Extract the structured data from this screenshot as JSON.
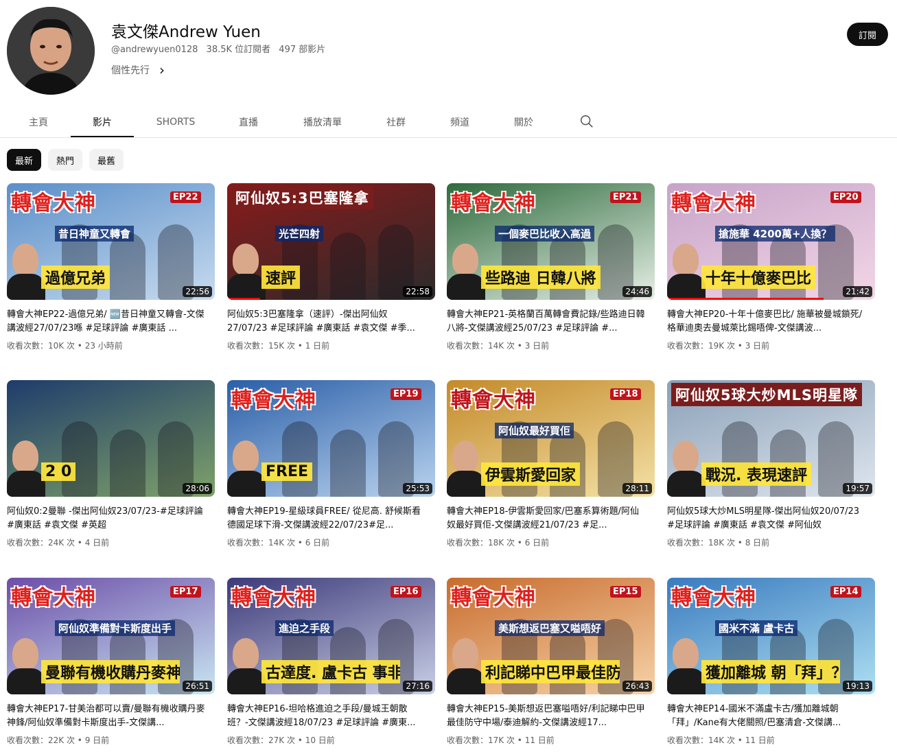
{
  "channel": {
    "name": "袁文傑Andrew Yuen",
    "handle": "@andrewyuen0128",
    "subscribers": "38.5K 位訂閱者",
    "video_count": "497 部影片",
    "about_link": "個性先行",
    "subscribe_label": "訂閱"
  },
  "tabs": [
    "主頁",
    "影片",
    "SHORTS",
    "直播",
    "播放清單",
    "社群",
    "頻道",
    "關於"
  ],
  "active_tab": "影片",
  "chips": [
    "最新",
    "熱門",
    "最舊"
  ],
  "active_chip": "最新",
  "videos": [
    {
      "title": "轉會大神EP22-過億兄弟/ 🆕昔日神童又轉會-文傑講波經27/07/23喺 #足球評論 #廣東話 ...",
      "views": "收看次數：10K 次",
      "age": "23 小時前",
      "duration": "22:56",
      "thumb": {
        "banner": "轉會大神",
        "ep": "EP22",
        "caption": "過億兄弟",
        "caption2": "昔日神童又轉會",
        "colors": [
          "#5b8fc9",
          "#c7dbef"
        ],
        "banner_color": "#e0201c"
      }
    },
    {
      "title": "阿仙奴5:3巴塞隆拿（速評）-傑出阿仙奴27/07/23 #足球評論 #廣東話 #袁文傑 #季...",
      "views": "收看次數：15K 次",
      "age": "1 日前",
      "duration": "22:58",
      "thumb": {
        "banner": "阿仙奴5:3巴塞隆拿",
        "ep": "",
        "caption": "速評",
        "caption2": "光芒四射",
        "colors": [
          "#8a1a1a",
          "#2b2b2b"
        ],
        "banner_color": "#ffffff"
      }
    },
    {
      "title": "轉會大神EP21-英格蘭百萬轉會費記錄/些路迪日韓八將-文傑講波經25/07/23 #足球評論 #...",
      "views": "收看次數：14K 次",
      "age": "3 日前",
      "duration": "24:46",
      "thumb": {
        "banner": "轉會大神",
        "ep": "EP21",
        "caption": "些路迪 日韓八將",
        "caption2": "一個麥巴比收入高過",
        "colors": [
          "#2f6b3d",
          "#e6efe6"
        ],
        "banner_color": "#e0201c"
      }
    },
    {
      "title": "轉會大神EP20-十年十億麥巴比/ 施華被曼城鎖死/ 格華迪奧去曼城萊比錫唔俾-文傑講波...",
      "views": "收看次數：19K 次",
      "age": "3 日前",
      "duration": "21:42",
      "thumb": {
        "banner": "轉會大神",
        "ep": "EP20",
        "caption": "十年十億麥巴比",
        "caption2": "搶施華 4200萬+人換？",
        "colors": [
          "#c7a3c9",
          "#f2d7e6"
        ],
        "banner_color": "#e0201c"
      }
    },
    {
      "title": "阿仙奴0:2曼聯 -傑出阿仙奴23/07/23-#足球評論 #廣東話 #袁文傑 #英超",
      "views": "收看次數：24K 次",
      "age": "4 日前",
      "duration": "28:06",
      "thumb": {
        "banner": "",
        "ep": "",
        "caption": "2  0",
        "caption2": "",
        "colors": [
          "#1e3c6b",
          "#7fa26a"
        ],
        "banner_color": "#ffffff"
      }
    },
    {
      "title": "轉會大神EP19-星級球員FREE/ 從尼高. 舒候斯看德國足球下滑-文傑講波經22/07/23#足...",
      "views": "收看次數：14K 次",
      "age": "6 日前",
      "duration": "25:53",
      "thumb": {
        "banner": "轉會大神",
        "ep": "EP19",
        "caption": "FREE",
        "caption2": "",
        "colors": [
          "#2b5fa8",
          "#b9d3ee"
        ],
        "banner_color": "#e0201c"
      }
    },
    {
      "title": "轉會大神EP18-伊雲斯愛回家/巴塞系算術題/阿仙奴最好買佢-文傑講波經21/07/23 #足...",
      "views": "收看次數：18K 次",
      "age": "6 日前",
      "duration": "28:11",
      "thumb": {
        "banner": "轉會大神",
        "ep": "EP18",
        "caption": "伊雲斯愛回家",
        "caption2": "阿仙奴最好買佢",
        "colors": [
          "#c48a2a",
          "#f3e1a6"
        ],
        "banner_color": "#c0141c"
      }
    },
    {
      "title": "阿仙奴5球大炒MLS明星隊-傑出阿仙奴20/07/23 #足球評論 #廣東話 #袁文傑 #阿仙奴",
      "views": "收看次數：18K 次",
      "age": "8 日前",
      "duration": "19:57",
      "thumb": {
        "banner": "阿仙奴5球大炒MLS明星隊",
        "ep": "",
        "caption": "戰況. 表現速評",
        "caption2": "",
        "colors": [
          "#8aa0b8",
          "#dfe6ee"
        ],
        "banner_color": "#ffffff"
      }
    },
    {
      "title": "轉會大神EP17-甘美治都可以賣/曼聯有機收購丹麥神鋒/阿仙奴準備對卡斯度出手-文傑講...",
      "views": "收看次數：22K 次",
      "age": "9 日前",
      "duration": "26:51",
      "thumb": {
        "banner": "轉會大神",
        "ep": "EP17",
        "caption": "曼聯有機收購丹麥神鋒",
        "caption2": "阿仙奴準備對卡斯度出手",
        "colors": [
          "#6d4ea8",
          "#c9e6f2"
        ],
        "banner_color": "#e0201c"
      }
    },
    {
      "title": "轉會大神EP16-坦哈格進迫之手段/曼城王朝散班？-文傑講波經18/07/23 #足球評論 #廣東...",
      "views": "收看次數：27K 次",
      "age": "10 日前",
      "duration": "27:16",
      "thumb": {
        "banner": "轉會大神",
        "ep": "EP16",
        "caption": "古達度. 盧卡古 事非沒完沒了",
        "caption2": "進迫之手段",
        "colors": [
          "#3d3a7a",
          "#c9cfe6"
        ],
        "banner_color": "#e0201c"
      }
    },
    {
      "title": "轉會大神EP15-美斯想返巴塞嗌唔好/利記睇中巴甲最佳防守中場/泰迪解約-文傑講波經17...",
      "views": "收看次數：17K 次",
      "age": "11 日前",
      "duration": "26:43",
      "thumb": {
        "banner": "轉會大神",
        "ep": "EP15",
        "caption": "利記睇中巴甲最佳防守中場",
        "caption2": "美斯想返巴塞又嗌唔好",
        "colors": [
          "#c86c2e",
          "#f6d3a8"
        ],
        "banner_color": "#e0201c"
      }
    },
    {
      "title": "轉會大神EP14-國米不滿盧卡古/獲加離城朝「拜」/Kane有大佬關照/巴塞清倉-文傑講...",
      "views": "收看次數：14K 次",
      "age": "11 日前",
      "duration": "19:13",
      "thumb": {
        "banner": "轉會大神",
        "ep": "EP14",
        "caption": "獲加離城 朝「拜」？",
        "caption2": "國米不滿 盧卡古",
        "colors": [
          "#3a7bbf",
          "#aee0f2"
        ],
        "banner_color": "#e0201c"
      }
    }
  ]
}
